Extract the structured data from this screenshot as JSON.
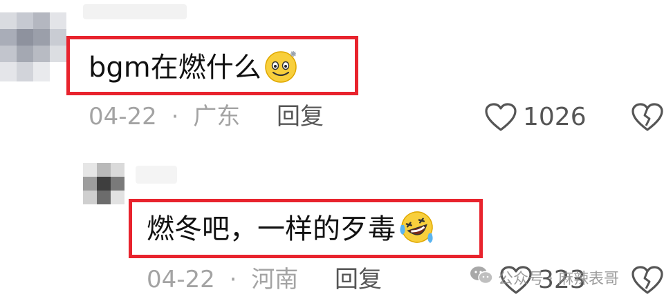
{
  "comments": [
    {
      "text": "bgm在燃什么",
      "emoji": "smiling-sweat-emoji",
      "date": "04-22",
      "separator": "·",
      "location": "广东",
      "reply_label": "回复",
      "likes": "1026"
    },
    {
      "text": "燃冬吧，一样的歹毒",
      "emoji": "laughing-crying-emoji",
      "date": "04-22",
      "separator": "·",
      "location": "河南",
      "reply_label": "回复",
      "likes": "323"
    }
  ],
  "watermark": {
    "icon": "wechat-icon",
    "text": "公众号 · 麻辣表哥"
  },
  "colors": {
    "highlight": "#e8232d",
    "meta_text": "#a3a3a3",
    "action_text": "#555555"
  }
}
